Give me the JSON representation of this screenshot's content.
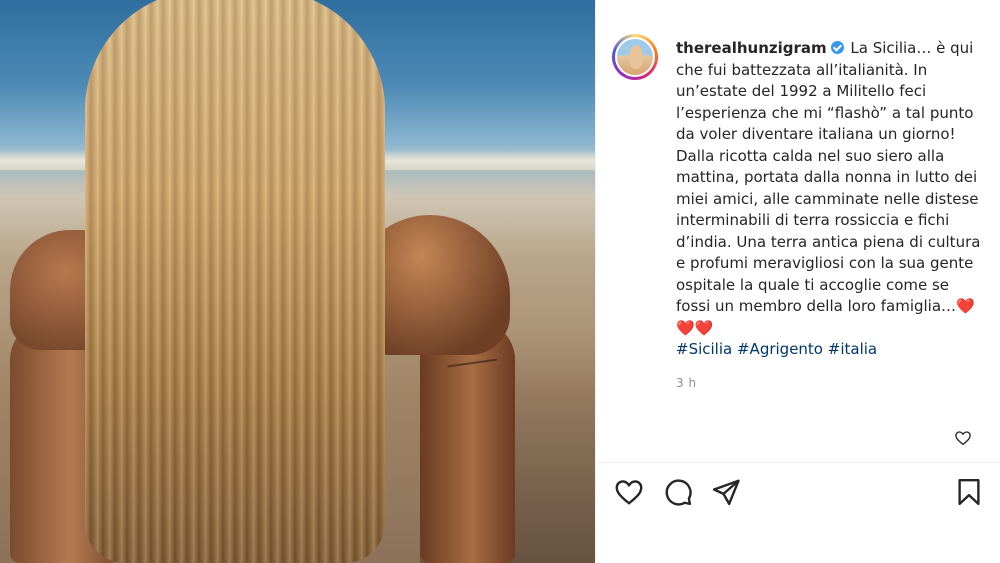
{
  "post": {
    "image_alt": "Beach photo of a woman with long wet blonde hair facing the sea",
    "author": {
      "username": "therealhunzigram",
      "verified": true,
      "avatar_icon": "profile-avatar"
    },
    "caption": {
      "text": " La Sicilia… è qui che fui battezzata all’italianità. In un’estate del 1992 a Militello feci l’esperienza che mi “flashò” a tal punto da voler diventare italiana un giorno! Dalla ricotta calda nel suo siero alla mattina, portata dalla nonna in lutto dei miei amici, alle camminate nelle distese interminabili di terra rossiccia e fichi d’india. Una terra antica piena di cultura e profumi meravigliosi con la sua gente ospitale la quale ti accoglie come se fossi un membro della loro famiglia…",
      "hearts": "❤️❤️❤️",
      "hashtags": [
        "#Sicilia",
        "#Agrigento",
        "#italia"
      ]
    },
    "time_ago": "3 h"
  },
  "actions": {
    "like_icon": "heart-outline-icon",
    "comment_icon": "comment-icon",
    "share_icon": "paper-plane-icon",
    "save_icon": "bookmark-icon",
    "comment_like_icon": "small-heart-icon"
  },
  "colors": {
    "text": "#262626",
    "hashtag": "#00376b",
    "verified": "#3897f0",
    "muted": "#8e8e8e",
    "divider": "#efefef"
  }
}
